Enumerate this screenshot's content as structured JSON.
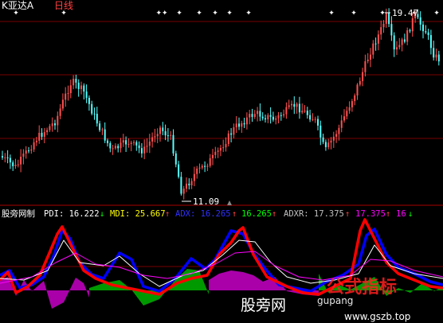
{
  "header": {
    "symbol": "K亚达A",
    "period": "日线"
  },
  "price_panel": {
    "high_label": "19.47",
    "low_label": "11.09"
  },
  "indicator_panel": {
    "name": "股旁网制",
    "pdi_label": "PDI: 16.222",
    "pdi_arrow": "↓",
    "mdi_label": "MDI: 25.667",
    "mdi_arrow": "↑",
    "adx_label": "ADX: 16.265",
    "adx_arrow": "↑",
    "adx_value_2": "16.265",
    "adx_value_2_arrow": "↑",
    "adxr_label": "ADXR: 17.375",
    "adxr_arrow": "↑",
    "adxr_value_2": "17.375",
    "adxr_value_2_arrow": "↑",
    "last_value": "16",
    "last_arrow": "↓"
  },
  "watermark": {
    "site_text": "股旁网",
    "url_text": "www.gszb.top",
    "domain_text": "gupang"
  },
  "colors": {
    "background": "#000000",
    "up_candle": "#ff5050",
    "down_candle": "#54ffff",
    "pdi": "#0000ff",
    "mdi": "#ff0000",
    "adx": "#ffffff",
    "adxr": "#ff00ff",
    "green_area": "#009900",
    "magenta_area": "#aa00aa",
    "grid": "#7a0000"
  }
}
